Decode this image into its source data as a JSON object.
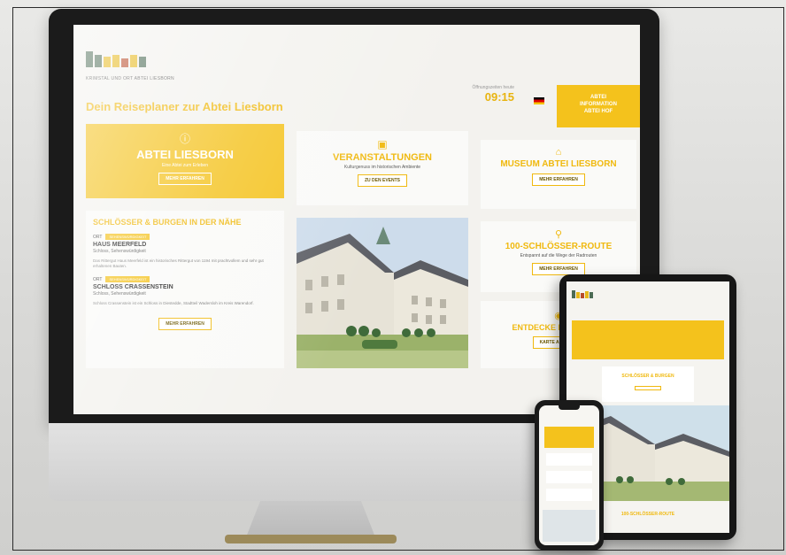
{
  "site": {
    "logo_tagline": "KRIMSTAL UND ORT ABTEI LIESBORN",
    "headline": "Dein Reiseplaner zur Abtei Liesborn",
    "time_label": "Öffnungszeiten heute",
    "time": "09:15",
    "ticket_lines": [
      "ABTEI",
      "INFORMATION",
      "ABTEI HOF"
    ]
  },
  "cards": {
    "abtei": {
      "icon": "info-icon",
      "title": "ABTEI LIESBORN",
      "subtitle": "Eine Abtei zum Erleben",
      "button": "MEHR ERFAHREN"
    },
    "events": {
      "icon": "calendar-icon",
      "title": "VERANSTALTUNGEN",
      "subtitle": "Kulturgenuss im historischen Ambiente",
      "button": "ZU DEN EVENTS"
    },
    "museum": {
      "icon": "museum-icon",
      "title": "MUSEUM ABTEI LIESBORN",
      "button": "MEHR ERFAHREN"
    },
    "route": {
      "icon": "bike-icon",
      "title": "100-SCHLÖSSER-ROUTE",
      "subtitle": "Entspannt auf die Wege der Radrouten",
      "button": "MEHR ERFAHREN"
    },
    "discover": {
      "icon": "map-icon",
      "title": "ENTDECKE DIE REGION",
      "button": "KARTE ANSEHEN"
    }
  },
  "castles": {
    "heading": "SCHLÖSSER & BURGEN IN DER NÄHE",
    "items": [
      {
        "date": "ORT",
        "tag": "SEHENSWÜRDIGKEIT",
        "name": "HAUS MEERFELD",
        "sub": "Schloss, Sehenswürdigkeit",
        "desc": "Das Rittergut Haus Meerfeld ist ein historisches Rittergut von 1194 mit prachtvollem und sehr gut erhaltenen Bauten."
      },
      {
        "date": "ORT",
        "tag": "SEHENSWÜRDIGKEIT",
        "name": "SCHLOSS CRASSENSTEIN",
        "sub": "Schloss, Sehenswürdigkeit",
        "desc": "Schloss Crassenstein ist ein Schloss in Diestedde, Stadtteil Wadersloh im Kreis Warendorf."
      }
    ],
    "button": "MEHR ERFAHREN"
  },
  "tablet": {
    "card_title": "SCHLÖSSER & BURGEN",
    "route_title": "100-SCHLÖSSER-ROUTE"
  },
  "colors": {
    "accent": "#f4c21c",
    "accent_text": "#f0b90f",
    "bezel": "#1b1b1b"
  }
}
